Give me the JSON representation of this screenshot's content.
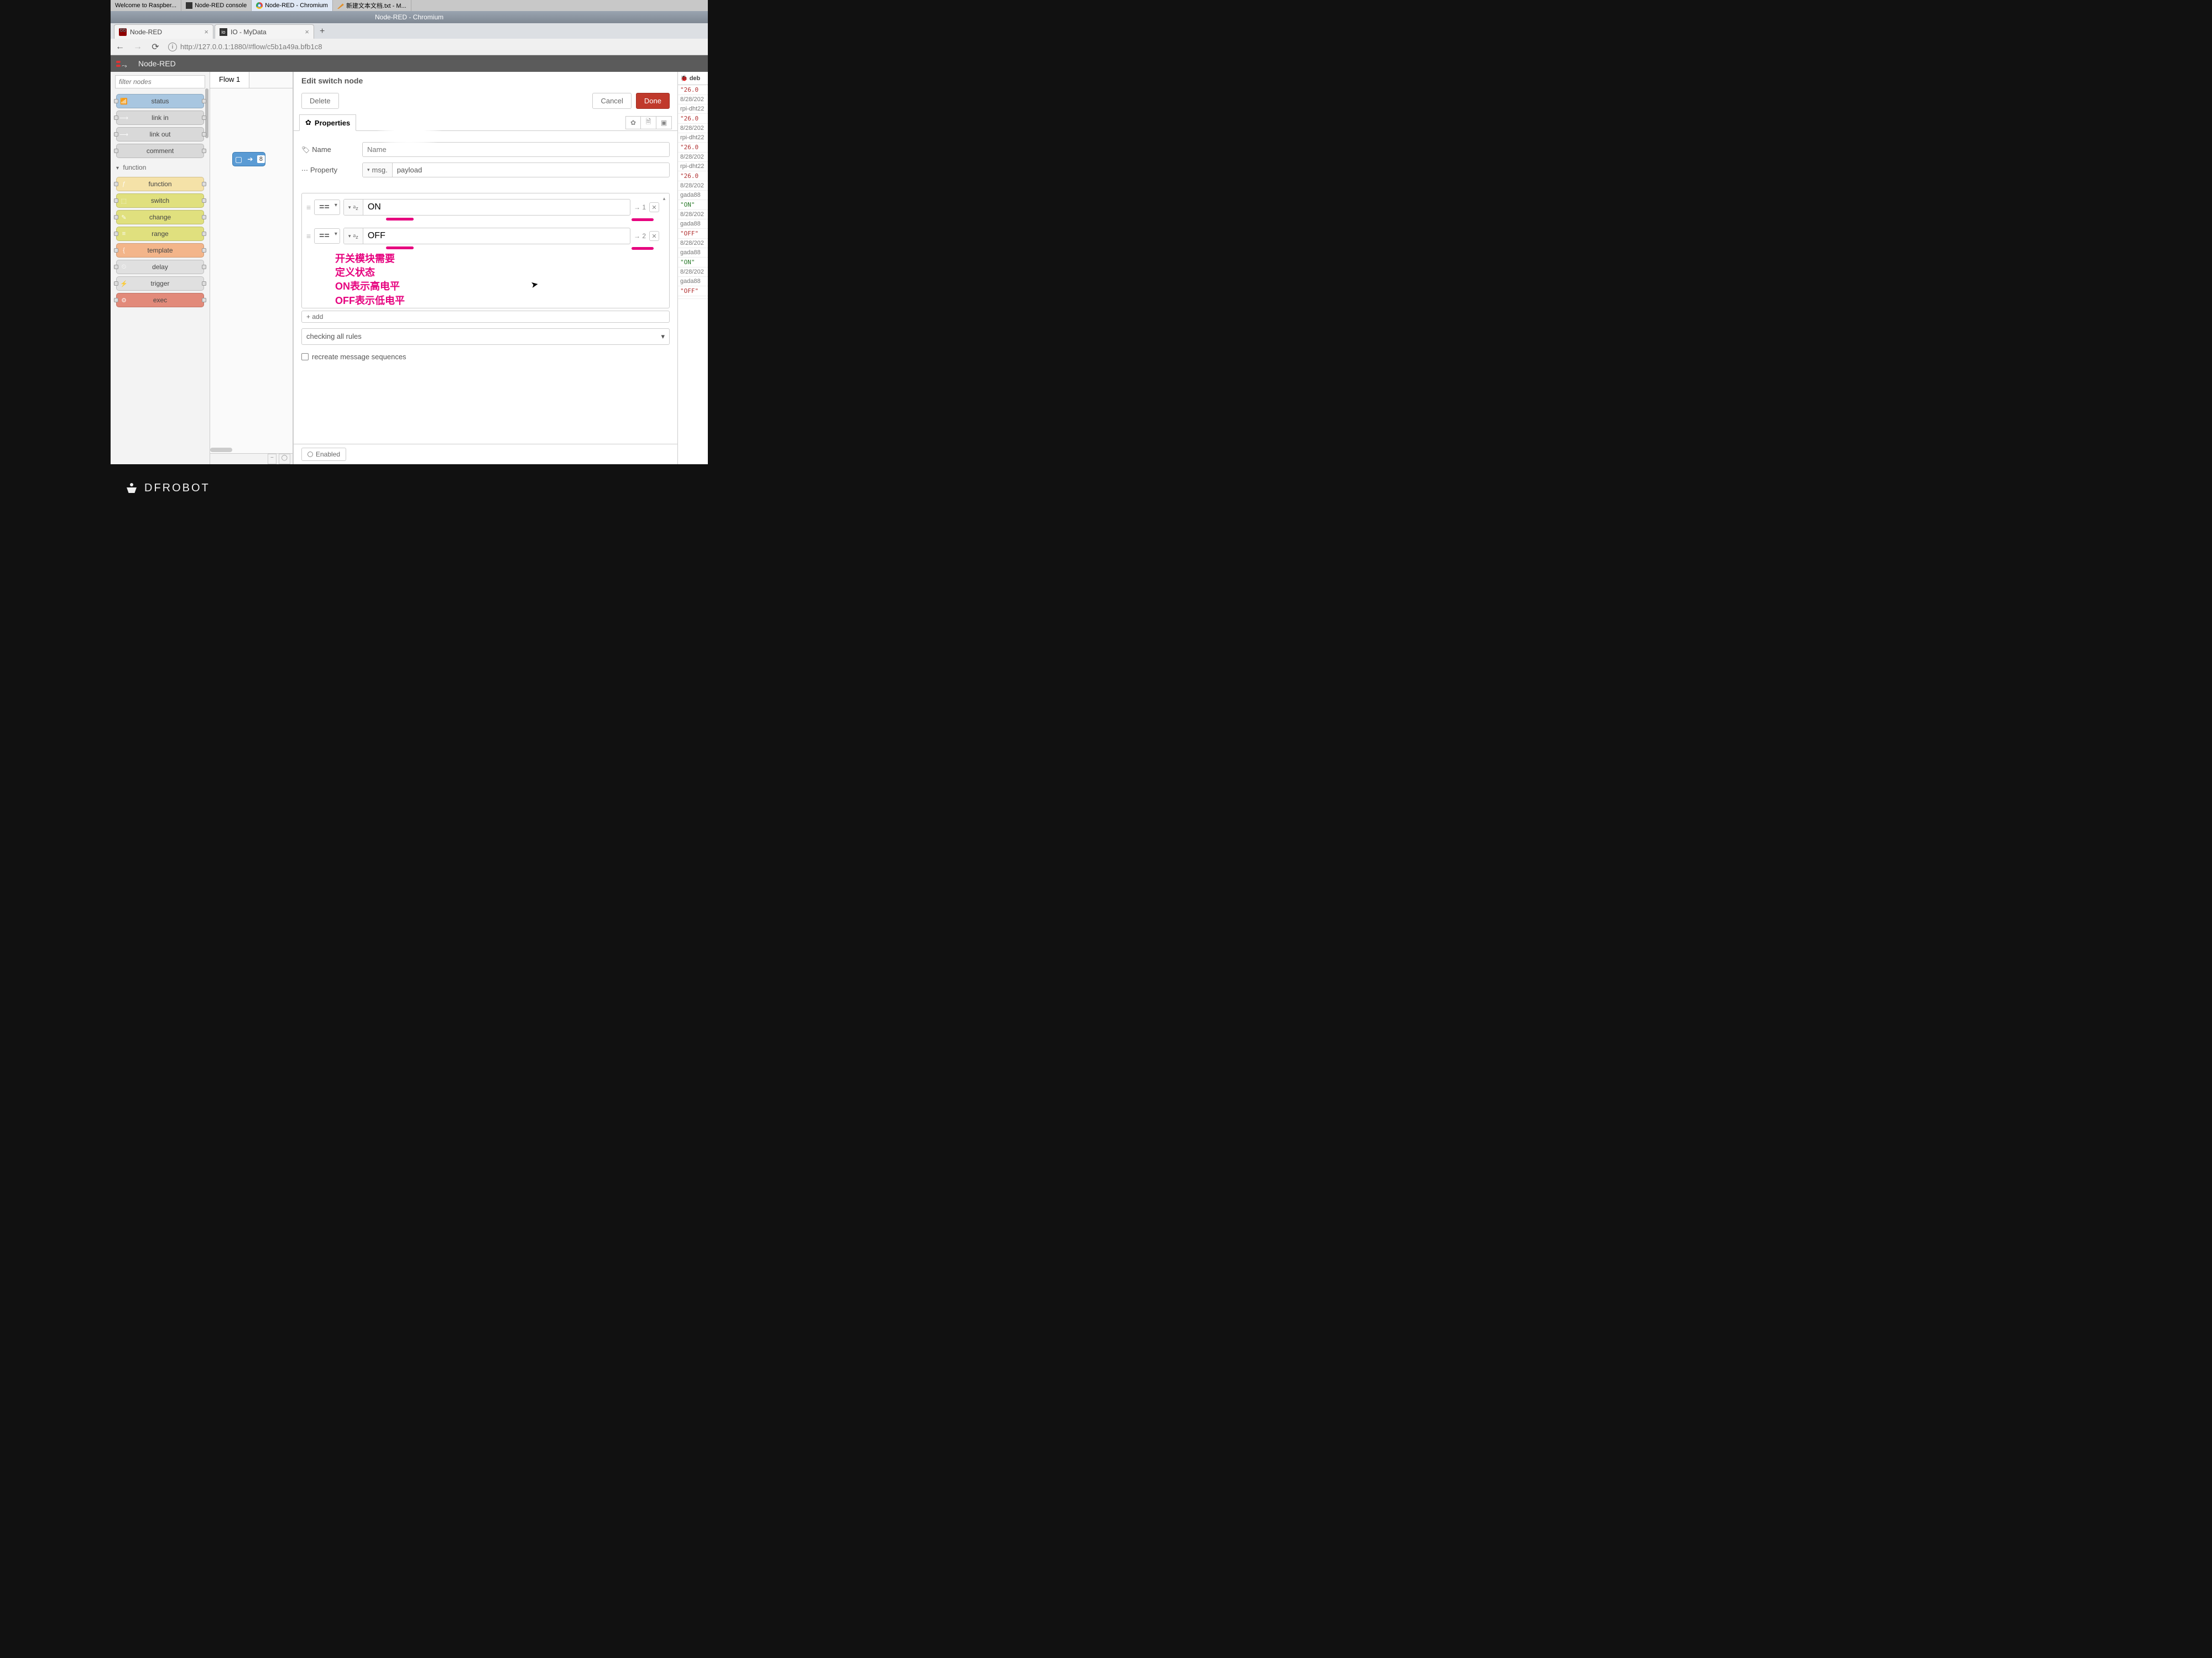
{
  "os": {
    "tasks": [
      {
        "label": "Welcome to Raspber...",
        "icon": "raspberry"
      },
      {
        "label": "Node-RED console",
        "icon": "terminal"
      },
      {
        "label": "Node-RED - Chromium",
        "icon": "chrome",
        "active": true
      },
      {
        "label": "新建文本文档.txt - M...",
        "icon": "pencil"
      }
    ]
  },
  "window": {
    "title": "Node-RED - Chromium"
  },
  "browser": {
    "tabs": [
      {
        "label": "Node-RED",
        "icon": "nodered"
      },
      {
        "label": "IO - MyData",
        "icon": "io"
      }
    ],
    "url": "http://127.0.0.1:1880/#flow/c5b1a49a.bfb1c8"
  },
  "nodered": {
    "brand": "Node-RED"
  },
  "palette": {
    "filter_placeholder": "filter nodes",
    "common": [
      {
        "label": "status",
        "color": "c-blue",
        "icon": "📶"
      },
      {
        "label": "link in",
        "color": "c-grey",
        "icon": "⟶"
      },
      {
        "label": "link out",
        "color": "c-grey",
        "icon": "⟶"
      },
      {
        "label": "comment",
        "color": "c-grey",
        "icon": ""
      }
    ],
    "function_label": "function",
    "function": [
      {
        "label": "function",
        "color": "c-fn",
        "icon": "ƒ"
      },
      {
        "label": "switch",
        "color": "c-sw",
        "icon": "⬚"
      },
      {
        "label": "change",
        "color": "c-sw",
        "icon": "✎"
      },
      {
        "label": "range",
        "color": "c-sw",
        "icon": "≡"
      },
      {
        "label": "template",
        "color": "c-tpl",
        "icon": "{"
      },
      {
        "label": "delay",
        "color": "c-dl",
        "icon": "⏲"
      },
      {
        "label": "trigger",
        "color": "c-dl",
        "icon": "⚡"
      },
      {
        "label": "exec",
        "color": "c-exec",
        "icon": "⚙"
      }
    ]
  },
  "workspace": {
    "tab": "Flow 1",
    "node_badge": "8"
  },
  "editor": {
    "title": "Edit switch node",
    "delete": "Delete",
    "cancel": "Cancel",
    "done": "Done",
    "properties_tab": "Properties",
    "name_label": "Name",
    "name_placeholder": "Name",
    "name_value": "",
    "property_label": "Property",
    "property_type": "msg.",
    "property_value": "payload",
    "rules": [
      {
        "op": "==",
        "val_type": "str",
        "value": "ON",
        "out": "→ 1"
      },
      {
        "op": "==",
        "val_type": "str",
        "value": "OFF",
        "out": "→ 2"
      }
    ],
    "add": "+ add",
    "checking_mode": "checking all rules",
    "recreate": "recreate message sequences",
    "enabled": "Enabled"
  },
  "annotation": {
    "l1": "开关模块需要",
    "l2": "定义状态",
    "l3a": "ON",
    "l3b": "表示高电平",
    "l4a": "OFF",
    "l4b": "表示低电平"
  },
  "debug": {
    "tab": "deb",
    "entries": [
      {
        "val": "\"26.0",
        "ts": "8/28/202",
        "src": "rpi-dht22"
      },
      {
        "val": "\"26.0",
        "ts": "8/28/202",
        "src": "rpi-dht22"
      },
      {
        "val": "\"26.0",
        "ts": "8/28/202",
        "src": "rpi-dht22"
      },
      {
        "val": "\"26.0",
        "ts": "8/28/202",
        "src": "gada88"
      },
      {
        "on": "\"ON\"",
        "ts": "8/28/202",
        "src": "gada88"
      },
      {
        "off": "\"OFF\"",
        "ts": "8/28/202",
        "src": "gada88"
      },
      {
        "on": "\"ON\"",
        "ts": "8/28/202",
        "src": "gada88"
      },
      {
        "off": "\"OFF\"",
        "ts": "",
        "src": ""
      }
    ]
  },
  "laptop": {
    "brand": "DFROBOT"
  }
}
